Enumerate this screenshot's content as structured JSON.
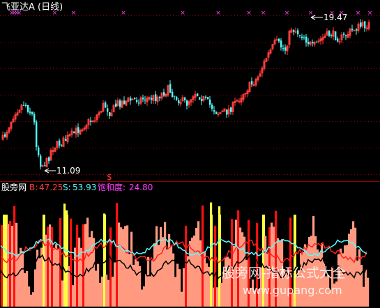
{
  "colors": {
    "background": "#000000",
    "grid": "#8b0000",
    "up": "#ff3c3c",
    "down": "#54ffff",
    "marker": "#ff3cff",
    "label_white": "#ffffff",
    "hist_salmon": "#ff9a80",
    "hist_red": "#ff1010",
    "hist_yellow": "#ffff40",
    "line_cyan": "#54ffff",
    "line_red": "#ff2020",
    "line_black": "#000000",
    "watermark": "#ffffff"
  },
  "upper_pane": {
    "title": "飞亚达A (日线)",
    "high_label": "19.47",
    "low_label": "11.09",
    "signal_label": "$"
  },
  "lower_pane": {
    "indicator_name": "股旁网",
    "b_label": "B:",
    "b_value": "47.25",
    "s_label": "S:",
    "s_value": "53.93",
    "sat_label": "饱和度:",
    "sat_value": "24.80"
  },
  "watermark": {
    "line1": "股旁网-指标公式大全",
    "line2": "www.gupang.com"
  },
  "chart_data": [
    {
      "type": "candlestick",
      "title": "飞亚达A (日线)",
      "annotations": [
        {
          "label": "19.47",
          "kind": "period high"
        },
        {
          "label": "11.09",
          "kind": "period low"
        }
      ],
      "ylim": [
        10.6,
        19.9
      ],
      "grid": true,
      "marker_positions": [
        1,
        2,
        3,
        4,
        19,
        27,
        48,
        73,
        88,
        101,
        107,
        117,
        127,
        136,
        140,
        147,
        152
      ]
    },
    {
      "type": "bar",
      "title": "股旁网",
      "series": [
        {
          "name": "B",
          "last": 47.25
        },
        {
          "name": "S",
          "last": 53.93
        },
        {
          "name": "饱和度",
          "last": 24.8
        }
      ],
      "ylim": [
        0,
        100
      ]
    }
  ]
}
